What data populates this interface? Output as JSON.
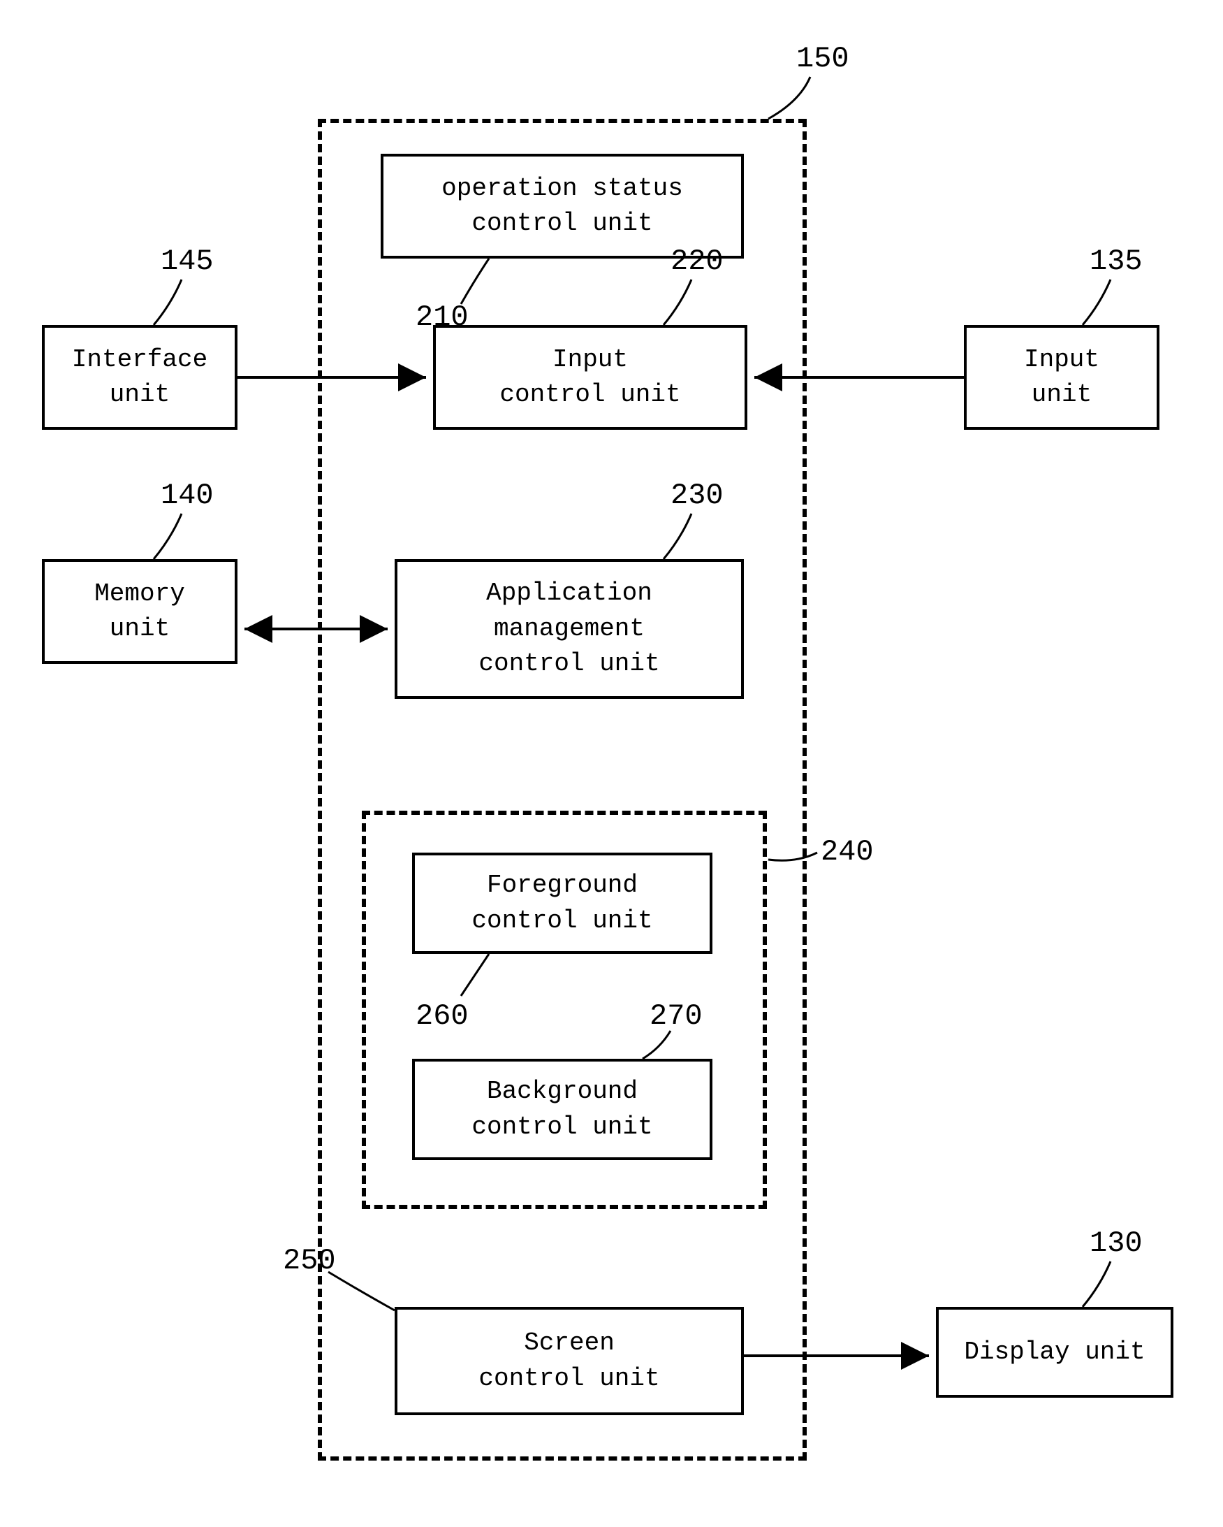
{
  "labels": {
    "n150": "150",
    "n145": "145",
    "n140": "140",
    "n135": "135",
    "n130": "130",
    "n210": "210",
    "n220": "220",
    "n230": "230",
    "n240": "240",
    "n250": "250",
    "n260": "260",
    "n270": "270"
  },
  "boxes": {
    "interface": "Interface\nunit",
    "memory": "Memory\nunit",
    "input": "Input\nunit",
    "display": "Display unit",
    "op_status": "operation status\ncontrol unit",
    "input_ctrl": "Input\ncontrol unit",
    "app_mgmt": "Application\nmanagement\ncontrol unit",
    "foreground": "Foreground\ncontrol unit",
    "background": "Background\ncontrol unit",
    "screen": "Screen\ncontrol unit"
  }
}
